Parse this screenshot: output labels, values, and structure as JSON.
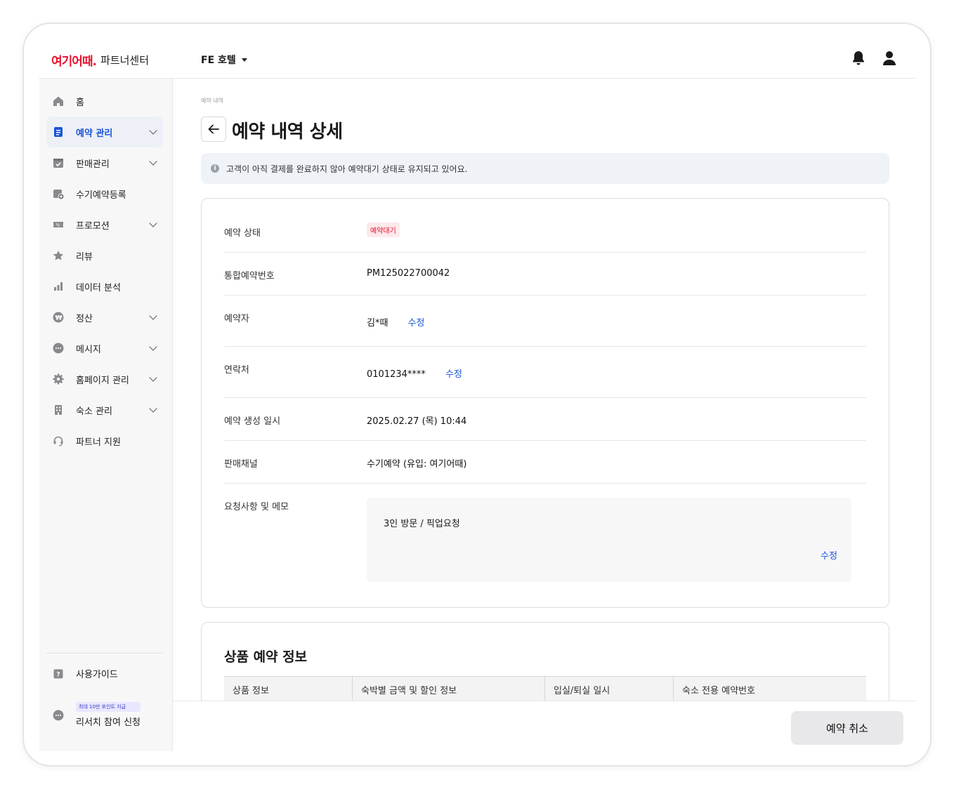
{
  "header": {
    "logo_mark": "여기어때.",
    "logo_text": "파트너센터",
    "hotel_name": "FE 호텔"
  },
  "sidebar": {
    "items": [
      {
        "label": "홈",
        "icon": "home-icon",
        "chevron": false,
        "active": false
      },
      {
        "label": "예약 관리",
        "icon": "document-icon",
        "chevron": true,
        "active": true
      },
      {
        "label": "판매관리",
        "icon": "calendar-check-icon",
        "chevron": true,
        "active": false
      },
      {
        "label": "수기예약등록",
        "icon": "calendar-plus-icon",
        "chevron": false,
        "active": false
      },
      {
        "label": "프로모션",
        "icon": "coupon-icon",
        "chevron": true,
        "active": false
      },
      {
        "label": "리뷰",
        "icon": "star-icon",
        "chevron": false,
        "active": false
      },
      {
        "label": "데이터 분석",
        "icon": "bar-chart-icon",
        "chevron": false,
        "active": false
      },
      {
        "label": "정산",
        "icon": "won-icon",
        "chevron": true,
        "active": false
      },
      {
        "label": "메시지",
        "icon": "chat-icon",
        "chevron": true,
        "active": false
      },
      {
        "label": "홈페이지 관리",
        "icon": "gear-icon",
        "chevron": true,
        "active": false
      },
      {
        "label": "숙소 관리",
        "icon": "building-icon",
        "chevron": true,
        "active": false
      },
      {
        "label": "파트너 지원",
        "icon": "headset-icon",
        "chevron": false,
        "active": false
      }
    ],
    "guide_label": "사용가이드",
    "research_badge": "최대 10만 포인트 지급",
    "research_label": "리서치 참여 신청"
  },
  "main": {
    "breadcrumb": "예약 내역",
    "title": "예약 내역 상세",
    "notice": "고객이 아직 결제를 완료하지 않아 예약대기 상태로 유지되고 있어요.",
    "details": {
      "status_label": "예약 상태",
      "status_value": "예약대기",
      "number_label": "통합예약번호",
      "number_value": "PM125022700042",
      "guest_label": "예약자",
      "guest_value": "김*때",
      "contact_label": "연락처",
      "contact_value": "0101234****",
      "created_label": "예약 생성 일시",
      "created_value": "2025.02.27 (목) 10:44",
      "channel_label": "판매채널",
      "channel_value": "수기예약 (유입: 여기어때)",
      "memo_label": "요청사항 및 메모",
      "memo_value": "3인 방문 / 픽업요청",
      "edit_label": "수정"
    },
    "product_section": {
      "title": "상품 예약 정보",
      "columns": [
        "상품 정보",
        "숙박별 금액 및 할인 정보",
        "입실/퇴실 일시",
        "숙소 전용 예약번호"
      ]
    }
  },
  "footer": {
    "cancel_label": "예약 취소"
  },
  "colors": {
    "brand": "#e8112d",
    "link": "#1a55d6",
    "active_bg": "#eef0f7"
  }
}
